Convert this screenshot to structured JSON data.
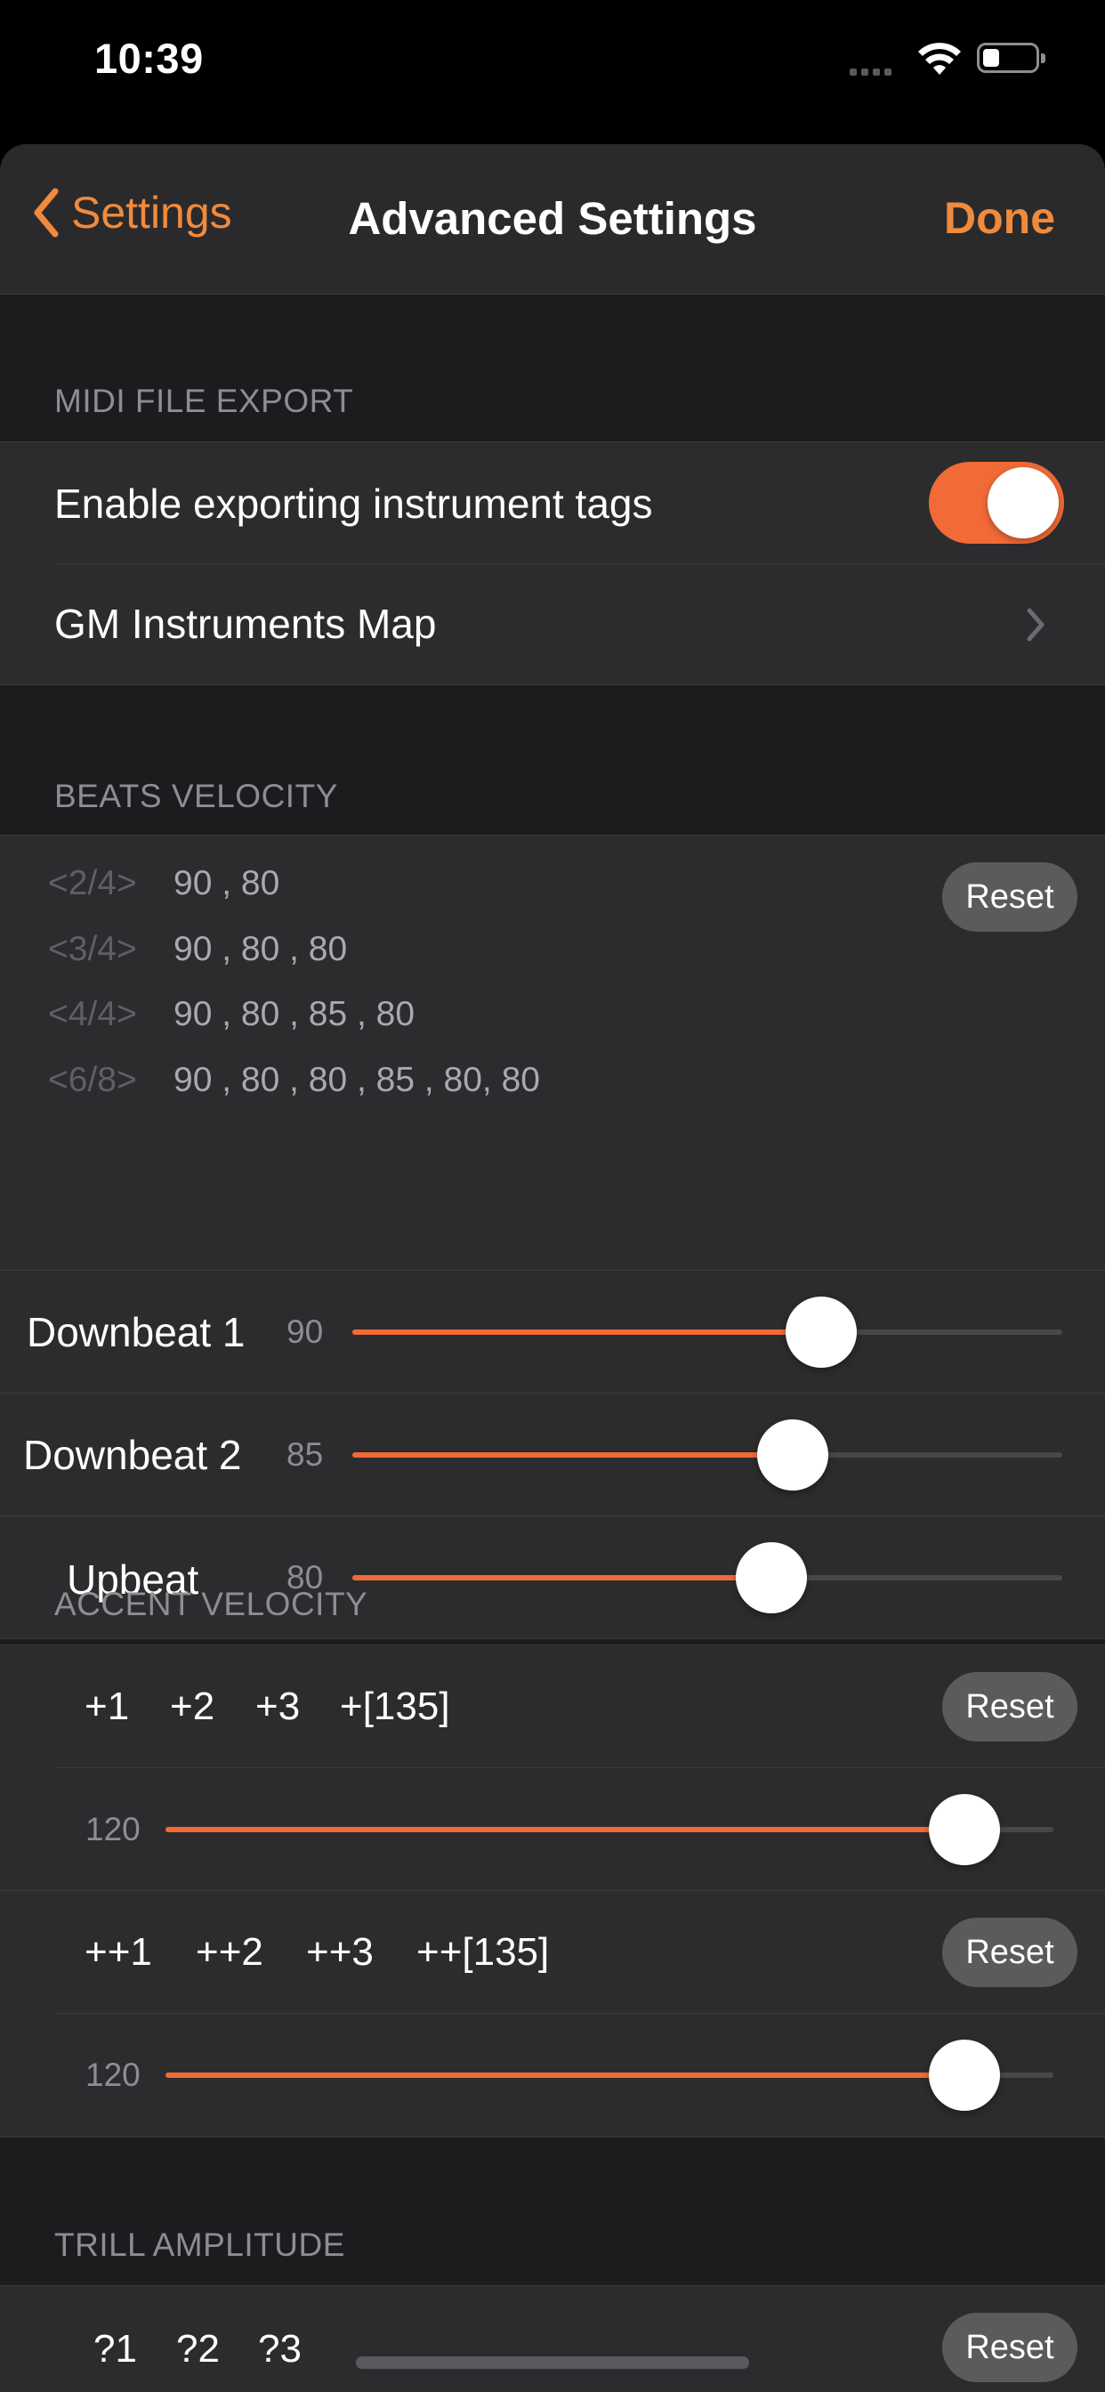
{
  "status": {
    "time": "10:39"
  },
  "nav": {
    "back_label": "Settings",
    "title": "Advanced Settings",
    "done_label": "Done"
  },
  "midi_export": {
    "header": "MIDI FILE EXPORT",
    "toggle_label": "Enable exporting instrument tags",
    "toggle_on": true,
    "map_label": "GM Instruments Map"
  },
  "beats_velocity": {
    "header": "BEATS VELOCITY",
    "signatures": [
      {
        "sig": "<2/4>",
        "values": "90 , 80"
      },
      {
        "sig": "<3/4>",
        "values": "90 , 80 , 80"
      },
      {
        "sig": "<4/4>",
        "values": "90 , 80 , 85 , 80"
      },
      {
        "sig": "<6/8>",
        "values": "90 , 80 , 80 , 85 , 80, 80"
      }
    ],
    "reset_label": "Reset",
    "sliders": [
      {
        "label": "Downbeat 1",
        "value": "90",
        "fraction": 0.66
      },
      {
        "label": "Downbeat 2",
        "value": "85",
        "fraction": 0.62
      },
      {
        "label": "Upbeat",
        "value": "80",
        "fraction": 0.59
      }
    ]
  },
  "accent_velocity": {
    "header": "ACCENT VELOCITY",
    "row1_items": [
      "+1",
      "+2",
      "+3",
      "+[135]"
    ],
    "row1_reset": "Reset",
    "row1_value": "120",
    "row1_fraction": 0.9,
    "row2_items": [
      "++1",
      "++2",
      "++3",
      "++[135]"
    ],
    "row2_reset": "Reset",
    "row2_value": "120",
    "row2_fraction": 0.9
  },
  "trill_amplitude": {
    "header": "TRILL AMPLITUDE",
    "items": [
      "?1",
      "?2",
      "?3"
    ],
    "reset_label": "Reset"
  },
  "colors": {
    "accent": "#f26a36",
    "nav_tint": "#f08a3c",
    "background": "#1c1c1e",
    "cell": "#2c2c2e"
  }
}
